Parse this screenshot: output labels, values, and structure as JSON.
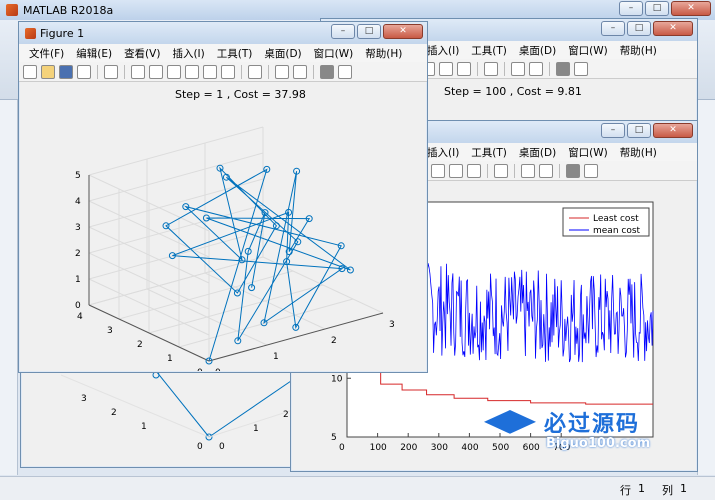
{
  "app": {
    "title": "MATLAB R2018a",
    "status_row_label": "行",
    "status_row_value": "1",
    "status_col_label": "列",
    "status_col_value": "1"
  },
  "menus": [
    "文件(F)",
    "编辑(E)",
    "查看(V)",
    "插入(I)",
    "工具(T)",
    "桌面(D)",
    "窗口(W)",
    "帮助(H)"
  ],
  "menus_partial": [
    "插入(I)",
    "工具(T)",
    "桌面(D)",
    "窗口(W)",
    "帮助(H)"
  ],
  "figure1": {
    "title": "Figure 1",
    "plot_title": "Step = 1 , Cost = 37.98"
  },
  "figure_back": {
    "plot_title": "Step = 100 , Cost = 9.81"
  },
  "watermark": {
    "text": "必过源码",
    "url": "Biguo100.com"
  },
  "chart_data": [
    {
      "type": "scatter",
      "title": "Step = 1 , Cost = 37.98",
      "xlim": [
        0,
        3
      ],
      "ylim": [
        0,
        4
      ],
      "zlim": [
        0,
        5
      ],
      "x_ticks": [
        "0",
        "1",
        "2",
        "3"
      ],
      "y_ticks": [
        "0",
        "1",
        "2",
        "3",
        "4"
      ],
      "z_ticks": [
        "0",
        "1",
        "2",
        "3",
        "4",
        "5"
      ],
      "color": "#0072bd",
      "points": [
        [
          0.0,
          0.0,
          0.0
        ],
        [
          2.6,
          3.1,
          4.1
        ],
        [
          0.5,
          2.4,
          3.6
        ],
        [
          0.8,
          0.6,
          1.8
        ],
        [
          2.3,
          2.2,
          2.6
        ],
        [
          2.0,
          3.5,
          4.3
        ],
        [
          1.5,
          1.8,
          2.0
        ],
        [
          1.1,
          2.9,
          3.7
        ],
        [
          2.9,
          1.2,
          2.0
        ],
        [
          1.6,
          0.2,
          0.2
        ],
        [
          1.7,
          0.7,
          2.4
        ],
        [
          2.2,
          1.6,
          3.5
        ],
        [
          0.3,
          1.8,
          2.9
        ],
        [
          2.5,
          0.4,
          1.8
        ],
        [
          1.0,
          0.1,
          0.8
        ],
        [
          2.7,
          2.3,
          4.4
        ],
        [
          1.9,
          1.0,
          2.5
        ],
        [
          2.4,
          1.3,
          3.3
        ],
        [
          1.3,
          2.6,
          3.3
        ],
        [
          2.8,
          0.7,
          1.4
        ],
        [
          1.8,
          2.9,
          4.4
        ],
        [
          2.1,
          1.1,
          2.7
        ],
        [
          0.6,
          0.2,
          0.3
        ],
        [
          1.4,
          1.4,
          2.6
        ],
        [
          2.0,
          2.0,
          3.4
        ],
        [
          1.2,
          0.9,
          1.6
        ]
      ]
    },
    {
      "type": "line",
      "xlim": [
        0,
        1000
      ],
      "ylim": [
        5,
        25
      ],
      "x_ticks": [
        "0",
        "100",
        "200",
        "300",
        "400",
        "500",
        "600",
        "700"
      ],
      "y_ticks": [
        "5",
        "10",
        "15"
      ],
      "legend": [
        "Least cost",
        "mean cost"
      ],
      "legend_placement": "top-right",
      "colors": [
        "#d62728",
        "#0000ff"
      ]
    }
  ]
}
